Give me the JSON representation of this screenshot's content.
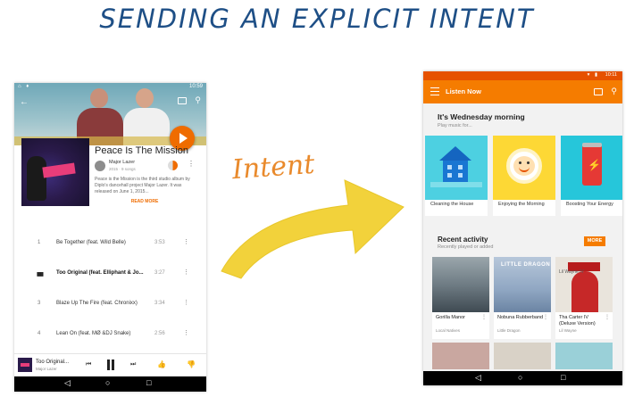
{
  "slide": {
    "title": "SENDING AN EXPLICIT INTENT",
    "arrow_label": "Intent"
  },
  "left_screen": {
    "status_time": "10:59",
    "album": {
      "title": "Peace Is The Mission",
      "artist": "Major Lazer",
      "meta": "2015 · 9 songs",
      "description": "Peace is the Mission is the third studio album by Diplo's dancehall project Major Lazer. It was released on June 1, 2015...",
      "read_more": "READ MORE"
    },
    "tracks": [
      {
        "num": "1",
        "title": "Be Together (feat. Wild Belle)",
        "duration": "3:53",
        "playing": false
      },
      {
        "num": "",
        "title": "Too Original (feat. Elliphant & Jo...",
        "duration": "3:27",
        "playing": true
      },
      {
        "num": "3",
        "title": "Blaze Up The Fire (feat. Chronixx)",
        "duration": "3:34",
        "playing": false
      },
      {
        "num": "4",
        "title": "Lean On (feat. MØ &DJ Snake)",
        "duration": "2:56",
        "playing": false
      }
    ],
    "now_playing": {
      "title": "Too Original...",
      "artist": "Major Lazer"
    }
  },
  "right_screen": {
    "status_time": "10:11",
    "toolbar_title": "Listen Now",
    "greeting": "It's Wednesday morning",
    "greeting_sub": "Play music for...",
    "cards": [
      {
        "caption": "Cleaning the House",
        "icon": "house-icon"
      },
      {
        "caption": "Enjoying the Morning",
        "icon": "breakfast-icon"
      },
      {
        "caption": "Boosting Your Energy",
        "icon": "energy-can-icon"
      }
    ],
    "recent_title": "Recent activity",
    "recent_sub": "Recently played or added",
    "more_label": "MORE",
    "albums": [
      {
        "name": "Gorilla Manor",
        "artist": "Local Natives",
        "cover_text": ""
      },
      {
        "name": "Nobuna Rubberband",
        "artist": "Little Dragon",
        "cover_text": "LITTLE DRAGON"
      },
      {
        "name": "Tha Carter IV (Deluxe Version)",
        "artist": "Lil Wayne",
        "cover_text": "Lil Wayne IV"
      }
    ]
  },
  "colors": {
    "title_blue": "#1e4f86",
    "intent_orange": "#e98a2c",
    "arrow_yellow": "#f2d23b",
    "toolbar_orange": "#f57c00",
    "play_orange": "#ef6c00"
  }
}
